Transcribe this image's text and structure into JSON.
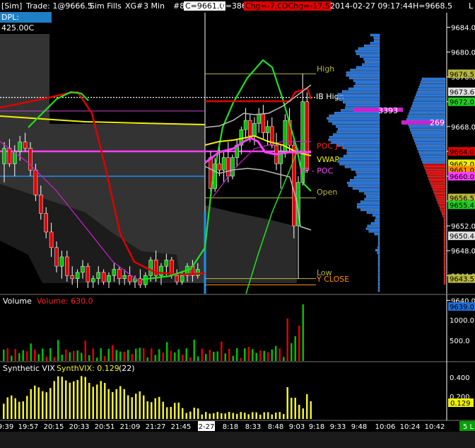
{
  "header": {
    "account": "[Sim]",
    "trade": "Trade: 1@9666.5",
    "fills": "Sim Fills",
    "instrument": "XG#",
    "interval": "3 Min",
    "bar": "#8",
    "close": "C=9661.0",
    "ticks": "T=386",
    "chg": "Chg=-7.0",
    "dchg": "DChg=-17.5",
    "datetime": "2014-02-27 09:17:44",
    "high": "H=9668.5",
    "tail": "L"
  },
  "dpl": "DPL: 425.00C",
  "colors": {
    "up": "#00c000",
    "down": "#e00000",
    "volume_bar": "#1e6ed8",
    "bull_vol": "#00c000",
    "bear_vol": "#e00000",
    "vix": "#f0f030",
    "poc": "#ff40ff",
    "ema_red": "#e00000",
    "ema_green": "#20e020",
    "ema_yellow": "#f0f000",
    "blue_line": "#1e8ff0"
  },
  "levels": {
    "high": "High",
    "ib_high": "IB High",
    "poc_j1": "POC J-1",
    "vwap": "VWAP",
    "pp_poc": "PP - POC",
    "open": "Open",
    "low": "Low",
    "y_close": "Y CLOSE"
  },
  "profile_labels": {
    "vol_left": "3393",
    "vol_right": "269"
  },
  "volume_pane": {
    "title": "Volume",
    "value": "Volume: 630.0",
    "axis": [
      "1000.0",
      "500.0"
    ]
  },
  "vix_pane": {
    "title": "Synthetic VIX",
    "value": "SynthVIX: 0.129",
    "period": "(22)",
    "axis": [
      "0.400",
      "0.200"
    ],
    "last": "0.129"
  },
  "x_ticks": [
    "9:39",
    "19:57",
    "20:15",
    "20:33",
    "20:51",
    "21:09",
    "21:27",
    "21:45",
    "2-27",
    "8:18",
    "8:33",
    "8:48",
    "9:03",
    "9:18",
    "9:33",
    "9:48",
    "10:06",
    "10:24",
    "10:42"
  ],
  "x_corner": "5 L",
  "chart_data": {
    "type": "candlestick",
    "y_axis_ticks": [
      "9684.0",
      "9680.0",
      "9676.0",
      "9672.0",
      "9668.0",
      "9664.0",
      "9660.0",
      "9656.0",
      "9652.0",
      "9648.0",
      "9644.0",
      "9640.0"
    ],
    "ylim": [
      9640,
      9685
    ],
    "price_tags": [
      {
        "value": "9676.5",
        "bg": "#b8b840"
      },
      {
        "value": "9673.6",
        "bg": "#e0e0e0"
      },
      {
        "value": "9672.0",
        "bg": "#20d020"
      },
      {
        "value": "9664.0",
        "bg": "#e00000"
      },
      {
        "value": "9662.0",
        "bg": "#f0f000"
      },
      {
        "value": "9661.0",
        "bg": "#ff9000"
      },
      {
        "value": "9660.0",
        "bg": "#ff40ff"
      },
      {
        "value": "9656.5",
        "bg": "#b8b840"
      },
      {
        "value": "9655.4",
        "bg": "#20d020"
      },
      {
        "value": "9650.4",
        "bg": "#e0e0e0"
      },
      {
        "value": "9643.5",
        "bg": "#b8b840"
      },
      {
        "value": "9639.0",
        "bg": "#1e6ed8"
      }
    ],
    "candles_session1": [
      [
        9662.0,
        9665.5,
        9659.0,
        9664.5
      ],
      [
        9664.5,
        9666.0,
        9661.5,
        9662.0
      ],
      [
        9662.0,
        9665.0,
        9660.0,
        9664.0
      ],
      [
        9664.0,
        9666.5,
        9662.5,
        9665.5
      ],
      [
        9665.5,
        9667.0,
        9664.0,
        9664.5
      ],
      [
        9664.5,
        9665.5,
        9660.0,
        9661.0
      ],
      [
        9661.0,
        9662.0,
        9656.0,
        9657.0
      ],
      [
        9657.0,
        9658.5,
        9653.0,
        9654.0
      ],
      [
        9654.0,
        9655.0,
        9650.0,
        9651.0
      ],
      [
        9651.0,
        9652.5,
        9647.0,
        9648.5
      ],
      [
        9648.5,
        9649.5,
        9644.5,
        9645.5
      ],
      [
        9645.5,
        9648.0,
        9643.5,
        9647.0
      ],
      [
        9647.0,
        9648.0,
        9643.0,
        9644.0
      ],
      [
        9644.0,
        9645.5,
        9642.5,
        9643.5
      ],
      [
        9643.5,
        9645.0,
        9642.0,
        9644.5
      ],
      [
        9644.5,
        9646.5,
        9643.5,
        9645.5
      ],
      [
        9645.5,
        9646.0,
        9642.0,
        9643.0
      ],
      [
        9643.0,
        9644.0,
        9642.0,
        9643.5
      ],
      [
        9643.5,
        9645.5,
        9642.5,
        9644.5
      ],
      [
        9644.5,
        9645.0,
        9642.5,
        9643.0
      ],
      [
        9643.0,
        9644.5,
        9642.0,
        9644.0
      ],
      [
        9644.0,
        9646.0,
        9643.0,
        9645.0
      ],
      [
        9645.0,
        9645.5,
        9642.5,
        9643.5
      ],
      [
        9643.5,
        9645.0,
        9642.5,
        9644.0
      ],
      [
        9644.0,
        9645.5,
        9642.5,
        9643.0
      ],
      [
        9643.0,
        9644.0,
        9642.0,
        9643.5
      ],
      [
        9643.5,
        9645.0,
        9642.0,
        9642.5
      ],
      [
        9642.5,
        9644.5,
        9642.0,
        9644.0
      ],
      [
        9644.0,
        9647.0,
        9643.0,
        9646.5
      ],
      [
        9646.5,
        9648.0,
        9643.0,
        9644.0
      ],
      [
        9644.0,
        9646.0,
        9642.5,
        9645.5
      ],
      [
        9645.5,
        9647.5,
        9644.0,
        9646.5
      ],
      [
        9646.5,
        9647.0,
        9643.5,
        9644.0
      ],
      [
        9644.0,
        9645.0,
        9642.5,
        9643.0
      ],
      [
        9643.0,
        9644.5,
        9642.5,
        9644.0
      ],
      [
        9644.0,
        9646.0,
        9643.0,
        9645.5
      ],
      [
        9645.5,
        9646.5,
        9643.0,
        9644.0
      ],
      [
        9644.0,
        9646.0,
        9643.5,
        9645.0
      ]
    ],
    "candles_session2": [
      [
        9663.0,
        9664.0,
        9657.0,
        9658.0
      ],
      [
        9658.0,
        9663.0,
        9657.5,
        9662.0
      ],
      [
        9662.0,
        9665.0,
        9660.0,
        9661.0
      ],
      [
        9661.0,
        9664.0,
        9659.0,
        9663.0
      ],
      [
        9663.0,
        9665.5,
        9659.0,
        9660.0
      ],
      [
        9660.0,
        9663.5,
        9659.5,
        9663.0
      ],
      [
        9663.0,
        9666.0,
        9661.5,
        9665.0
      ],
      [
        9665.0,
        9668.0,
        9663.5,
        9667.5
      ],
      [
        9667.5,
        9671.0,
        9666.0,
        9669.0
      ],
      [
        9669.0,
        9670.0,
        9665.5,
        9666.5
      ],
      [
        9666.5,
        9669.5,
        9665.0,
        9668.5
      ],
      [
        9668.5,
        9671.0,
        9667.0,
        9670.0
      ],
      [
        9670.0,
        9671.5,
        9666.0,
        9667.0
      ],
      [
        9667.0,
        9669.0,
        9665.0,
        9668.0
      ],
      [
        9668.0,
        9669.5,
        9664.5,
        9665.0
      ],
      [
        9665.0,
        9667.0,
        9661.0,
        9662.0
      ],
      [
        9662.0,
        9665.0,
        9658.0,
        9664.0
      ],
      [
        9664.0,
        9670.0,
        9663.0,
        9669.0
      ],
      [
        9669.0,
        9671.0,
        9664.0,
        9665.0
      ],
      [
        9665.0,
        9666.0,
        9650.0,
        9652.0
      ],
      [
        9652.0,
        9660.0,
        9643.5,
        9659.0
      ],
      [
        9659.0,
        9676.5,
        9658.5,
        9672.0
      ],
      [
        9672.0,
        9673.5,
        9660.5,
        9661.0
      ]
    ]
  }
}
